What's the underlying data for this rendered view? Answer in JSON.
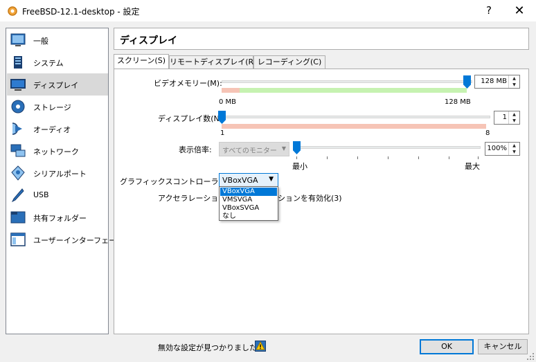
{
  "window": {
    "title": "FreeBSD-12.1-desktop - 設定",
    "help": "?",
    "close": "✕"
  },
  "sidebar": {
    "items": [
      {
        "label": "一般",
        "icon": "general-icon"
      },
      {
        "label": "システム",
        "icon": "system-icon"
      },
      {
        "label": "ディスプレイ",
        "icon": "display-icon",
        "selected": true
      },
      {
        "label": "ストレージ",
        "icon": "storage-icon"
      },
      {
        "label": "オーディオ",
        "icon": "audio-icon"
      },
      {
        "label": "ネットワーク",
        "icon": "network-icon"
      },
      {
        "label": "シリアルポート",
        "icon": "serial-port-icon"
      },
      {
        "label": "USB",
        "icon": "usb-icon"
      },
      {
        "label": "共有フォルダー",
        "icon": "shared-folder-icon"
      },
      {
        "label": "ユーザーインターフェース",
        "icon": "user-interface-icon"
      }
    ]
  },
  "main": {
    "title": "ディスプレイ",
    "tabs": [
      {
        "label": "スクリーン(S)",
        "active": true
      },
      {
        "label": "リモートディスプレイ(R)"
      },
      {
        "label": "レコーディング(C)"
      }
    ],
    "video_memory": {
      "label": "ビデオメモリー(M):",
      "value": "128 MB",
      "min_label": "0 MB",
      "max_label": "128 MB",
      "level": 1.0
    },
    "monitor_count": {
      "label": "ディスプレイ数(N):",
      "value": "1",
      "min_label": "1",
      "max_label": "8",
      "level": 0.0
    },
    "scale_factor": {
      "label": "表示倍率:",
      "monitor_select": "すべてのモニター",
      "value": "100%",
      "min_label": "最小",
      "max_label": "最大",
      "level": 0.0
    },
    "graphics_controller": {
      "label": "グラフィックスコントローラー(G):",
      "value": "VBoxVGA",
      "options": [
        "VBoxVGA",
        "VMSVGA",
        "VBoxSVGA",
        "なし"
      ],
      "selected_index": 0
    },
    "acceleration": {
      "label": "アクセラレーション:",
      "partial_text": "ションを有効化(3)"
    }
  },
  "footer": {
    "warning": "無効な設定が見つかりました",
    "ok": "OK",
    "cancel": "キャンセル"
  },
  "colors": {
    "accent": "#0078d7",
    "selection_bg": "#d9d9d9",
    "green_range": "#c6f2b1",
    "red_range": "#f6c4b6"
  }
}
